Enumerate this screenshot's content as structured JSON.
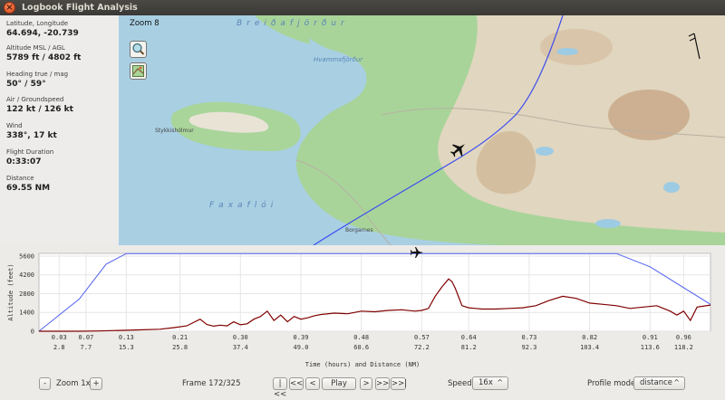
{
  "window": {
    "title": "Logbook Flight Analysis",
    "close_glyph": "×"
  },
  "stats": [
    {
      "label": "Latitude, Longitude",
      "value": "64.694, -20.739"
    },
    {
      "label": "Altitude MSL / AGL",
      "value": "5789 ft / 4802 ft"
    },
    {
      "label": "Heading true / mag",
      "value": "50° / 59°"
    },
    {
      "label": "Air / Groundspeed",
      "value": "122 kt / 126 kt"
    },
    {
      "label": "Wind",
      "value": "338°, 17 kt"
    },
    {
      "label": "Flight Duration",
      "value": "0:33:07"
    },
    {
      "label": "Distance",
      "value": "69.55 NM"
    }
  ],
  "map": {
    "zoom_label": "Zoom 8",
    "tools": [
      "zoom-in-icon",
      "map-layer-icon"
    ],
    "place_labels": [
      {
        "text": "Breiðafjörður"
      },
      {
        "text": "Hvammsfjörður"
      },
      {
        "text": "Faxaflói"
      },
      {
        "text": "Stykkishólmur"
      },
      {
        "text": "Borgarnes"
      }
    ],
    "colors": {
      "sea": "#a9cfe3",
      "lowland": "#a9d69a",
      "highland": "#dfd3bb",
      "track": "#3d4ef0"
    }
  },
  "chart_data": {
    "type": "line",
    "ylabel": "Altitude (feet)",
    "xlabel": "Time (hours) and Distance (NM)",
    "yticks": [
      "0",
      "1400",
      "2800",
      "4200",
      "5600"
    ],
    "ylim": [
      0,
      5800
    ],
    "xlim": [
      0,
      1.0
    ],
    "time_ticks": [
      "0.03",
      "0.07",
      "0.13",
      "0.21",
      "0.30",
      "0.39",
      "0.48",
      "0.57",
      "0.64",
      "0.73",
      "0.82",
      "0.91",
      "0.96"
    ],
    "distance_ticks": [
      "2.8",
      "7.7",
      "15.3",
      "25.8",
      "37.4",
      "49.0",
      "60.6",
      "72.2",
      "81.2",
      "92.3",
      "103.4",
      "113.6",
      "118.2"
    ],
    "tick_x": [
      0.03,
      0.07,
      0.13,
      0.21,
      0.3,
      0.39,
      0.48,
      0.57,
      0.64,
      0.73,
      0.82,
      0.91,
      0.96
    ],
    "series": [
      {
        "color": "#5060f0",
        "x": [
          0.0,
          0.06,
          0.1,
          0.13,
          0.86,
          0.91,
          1.0
        ],
        "y": [
          0,
          2400,
          5000,
          5789,
          5789,
          4800,
          2000
        ]
      },
      {
        "color": "#800000",
        "x": [
          0.0,
          0.03,
          0.06,
          0.09,
          0.12,
          0.15,
          0.18,
          0.2,
          0.22,
          0.24,
          0.25,
          0.26,
          0.27,
          0.28,
          0.29,
          0.3,
          0.31,
          0.32,
          0.33,
          0.34,
          0.35,
          0.36,
          0.37,
          0.38,
          0.39,
          0.4,
          0.41,
          0.42,
          0.44,
          0.46,
          0.48,
          0.5,
          0.52,
          0.54,
          0.56,
          0.57,
          0.58,
          0.59,
          0.6,
          0.61,
          0.615,
          0.62,
          0.63,
          0.64,
          0.65,
          0.66,
          0.68,
          0.7,
          0.72,
          0.74,
          0.76,
          0.78,
          0.8,
          0.82,
          0.84,
          0.86,
          0.88,
          0.9,
          0.92,
          0.94,
          0.95,
          0.96,
          0.97,
          0.98,
          1.0
        ],
        "y": [
          0,
          0,
          0,
          20,
          60,
          100,
          150,
          260,
          400,
          900,
          500,
          380,
          450,
          400,
          700,
          480,
          550,
          900,
          1100,
          1500,
          800,
          1200,
          700,
          1100,
          900,
          1000,
          1150,
          1250,
          1350,
          1300,
          1500,
          1450,
          1550,
          1600,
          1500,
          1550,
          1700,
          2600,
          3300,
          3900,
          3700,
          3200,
          1900,
          1750,
          1700,
          1650,
          1650,
          1700,
          1750,
          1900,
          2300,
          2600,
          2450,
          2100,
          2000,
          1900,
          1700,
          1800,
          1900,
          1500,
          1200,
          1500,
          800,
          1800,
          1950
        ]
      }
    ]
  },
  "controls": {
    "zoom_minus": "-",
    "zoom_label": "Zoom 1x",
    "zoom_plus": "+",
    "frame_label": "Frame 172/325",
    "nav": [
      "|<<",
      "<<",
      "<",
      "Play",
      ">",
      ">>",
      ">>|"
    ],
    "speed_label": "Speed",
    "speed_value": "16x",
    "profile_label": "Profile mode",
    "profile_value": "distance"
  }
}
